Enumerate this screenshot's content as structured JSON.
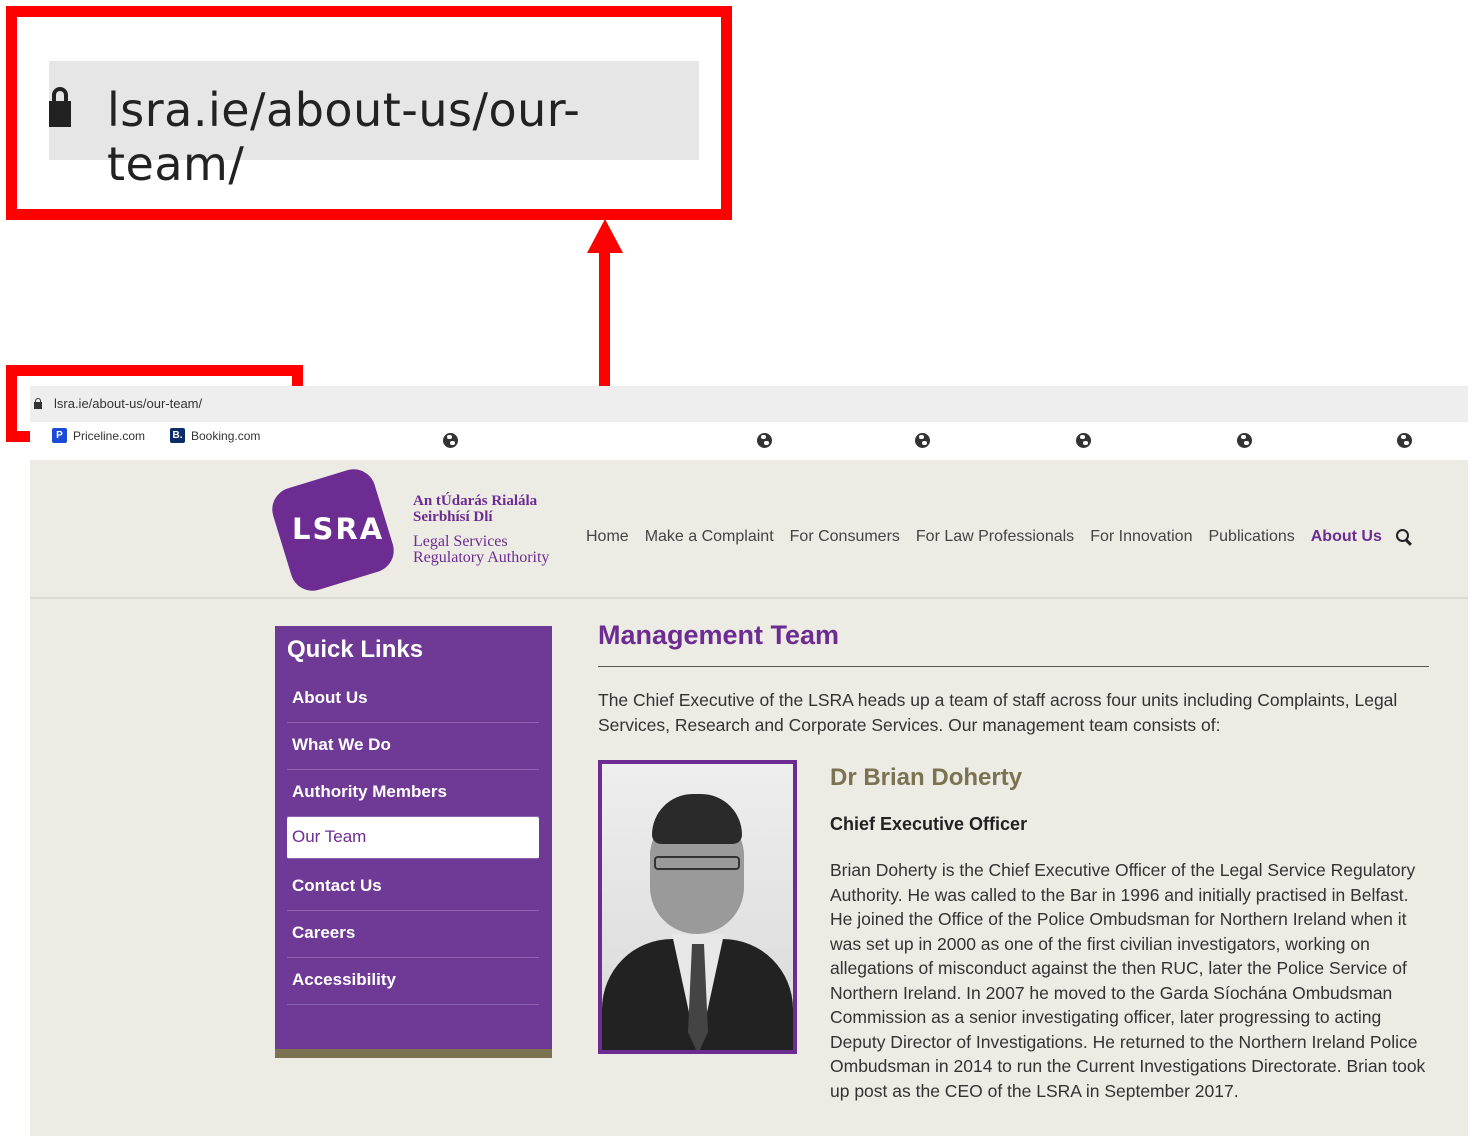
{
  "zoomed_url": "lsra.ie/about-us/our-team/",
  "browser": {
    "url": "lsra.ie/about-us/our-team/",
    "bookmarks": [
      {
        "label": "Priceline.com",
        "fav": "P"
      },
      {
        "label": "Booking.com",
        "fav": "B."
      }
    ]
  },
  "site": {
    "logo": {
      "abbr": "LSRA",
      "irish_line1": "An tÚdarás Rialála",
      "irish_line2": "Seirbhísí Dlí",
      "english_line1": "Legal Services",
      "english_line2": "Regulatory Authority"
    },
    "nav": [
      "Home",
      "Make a Complaint",
      "For Consumers",
      "For Law Professionals",
      "For Innovation",
      "Publications",
      "About Us"
    ],
    "nav_active": "About Us",
    "quick_links": {
      "title": "Quick Links",
      "items": [
        "About Us",
        "What We Do",
        "Authority Members",
        "Our Team",
        "Contact Us",
        "Careers",
        "Accessibility"
      ],
      "active": "Our Team"
    },
    "content": {
      "title": "Management Team",
      "intro": "The Chief Executive of the LSRA heads up a team of staff across four units including Complaints, Legal Services, Research and Corporate Services. Our management team consists of:",
      "person": {
        "name": "Dr Brian Doherty",
        "role": "Chief Executive Officer",
        "bio": "Brian Doherty is the Chief Executive Officer of the Legal Service Regulatory Authority. He was called to the Bar in 1996 and initially practised in Belfast. He joined the Office of the Police Ombudsman for Northern Ireland when it was set up in 2000 as one of the first civilian investigators, working on allegations of misconduct against the then RUC, later the Police Service of Northern Ireland. In 2007 he moved to the Garda Síochána Ombudsman Commission as a senior investigating officer, later progressing to acting Deputy Director of Investigations. He returned to the Northern Ireland Police Ombudsman in 2014 to run the Current Investigations Directorate. Brian took up post as the CEO of the LSRA in September 2017."
      }
    }
  },
  "colors": {
    "annotation": "#ff0000",
    "brand_purple": "#6d2c91",
    "accent_olive": "#7a7250",
    "page_bg": "#ecebe4"
  }
}
